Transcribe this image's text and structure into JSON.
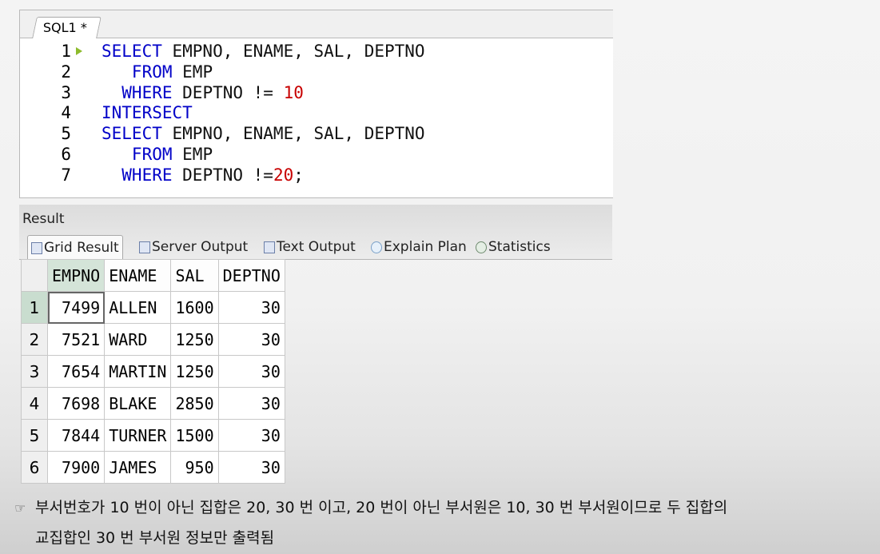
{
  "editor": {
    "tab_label": "SQL1 *",
    "lines": [
      {
        "n": "1",
        "code": [
          {
            "t": "SELECT",
            "c": "kw"
          },
          {
            "t": " EMPNO, ENAME, SAL, DEPTNO",
            "c": "plain"
          }
        ]
      },
      {
        "n": "2",
        "code": [
          {
            "t": "   FROM",
            "c": "kw"
          },
          {
            "t": " EMP",
            "c": "plain"
          }
        ]
      },
      {
        "n": "3",
        "code": [
          {
            "t": "  WHERE",
            "c": "kw"
          },
          {
            "t": " DEPTNO != ",
            "c": "plain"
          },
          {
            "t": "10",
            "c": "num"
          }
        ]
      },
      {
        "n": "4",
        "code": [
          {
            "t": "INTERSECT",
            "c": "kw"
          }
        ]
      },
      {
        "n": "5",
        "code": [
          {
            "t": "SELECT",
            "c": "kw"
          },
          {
            "t": " EMPNO, ENAME, SAL, DEPTNO",
            "c": "plain"
          }
        ]
      },
      {
        "n": "6",
        "code": [
          {
            "t": "   FROM",
            "c": "kw"
          },
          {
            "t": " EMP",
            "c": "plain"
          }
        ]
      },
      {
        "n": "7",
        "code": [
          {
            "t": "  WHERE",
            "c": "kw"
          },
          {
            "t": " DEPTNO !=",
            "c": "plain"
          },
          {
            "t": "20",
            "c": "num"
          },
          {
            "t": ";",
            "c": "plain"
          }
        ]
      }
    ]
  },
  "result": {
    "title": "Result",
    "tabs": [
      {
        "label": "Grid Result",
        "icon": "grid-icon"
      },
      {
        "label": "Server Output",
        "icon": "server-output-icon"
      },
      {
        "label": "Text Output",
        "icon": "text-output-icon"
      },
      {
        "label": "Explain Plan",
        "icon": "explain-plan-icon"
      },
      {
        "label": "Statistics",
        "icon": "statistics-icon"
      }
    ],
    "columns": [
      "EMPNO",
      "ENAME",
      "SAL",
      "DEPTNO"
    ],
    "rows": [
      {
        "rn": "1",
        "cells": [
          "7499",
          "ALLEN",
          "1600",
          "30"
        ]
      },
      {
        "rn": "2",
        "cells": [
          "7521",
          "WARD",
          "1250",
          "30"
        ]
      },
      {
        "rn": "3",
        "cells": [
          "7654",
          "MARTIN",
          "1250",
          "30"
        ]
      },
      {
        "rn": "4",
        "cells": [
          "7698",
          "BLAKE",
          "2850",
          "30"
        ]
      },
      {
        "rn": "5",
        "cells": [
          "7844",
          "TURNER",
          "1500",
          "30"
        ]
      },
      {
        "rn": "6",
        "cells": [
          "7900",
          "JAMES",
          "950",
          "30"
        ]
      }
    ]
  },
  "note": {
    "bullet": "☞",
    "line1": "부서번호가 10 번이 아닌 집합은 20, 30 번 이고, 20 번이 아닌 부서원은 10, 30 번 부서원이므로 두 집합의",
    "line2": "교집합인 30 번 부서원 정보만 출력됨"
  }
}
